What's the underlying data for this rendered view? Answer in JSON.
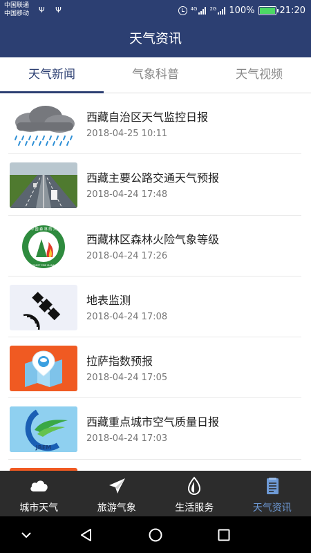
{
  "status_bar": {
    "carrier_1": "中国联通",
    "carrier_2": "中国移动",
    "net_label_1": "4G",
    "net_label_2": "2G",
    "battery": "100%",
    "time": "21:20"
  },
  "header": {
    "title": "天气资讯"
  },
  "tabs": [
    {
      "label": "天气新闻",
      "active": true
    },
    {
      "label": "气象科普",
      "active": false
    },
    {
      "label": "天气视频",
      "active": false
    }
  ],
  "news": [
    {
      "title": "西藏自治区天气监控日报",
      "date": "2018-04-25 10:11",
      "thumb": "rain-cloud"
    },
    {
      "title": "西藏主要公路交通天气预报",
      "date": "2018-04-24 17:48",
      "thumb": "highway-photo"
    },
    {
      "title": "西藏林区森林火险气象等级",
      "date": "2018-04-24 17:26",
      "thumb": "forest-fire-emblem"
    },
    {
      "title": "地表监测",
      "date": "2018-04-24 17:08",
      "thumb": "satellite"
    },
    {
      "title": "拉萨指数预报",
      "date": "2018-04-24 17:05",
      "thumb": "map-pin"
    },
    {
      "title": "西藏重点城市空气质量日报",
      "date": "2018-04-24 17:03",
      "thumb": "jbem-logo"
    }
  ],
  "forest_emblem": {
    "top_text": "中 国 森 林 防 火",
    "bottom_text": "CHINA FOREST FIRE MANAGEMENT"
  },
  "air_logo_text": "JBEM",
  "bottom_nav": [
    {
      "label": "城市天气",
      "icon": "cloud-icon",
      "active": false
    },
    {
      "label": "旅游气象",
      "icon": "paper-plane-icon",
      "active": false
    },
    {
      "label": "生活服务",
      "icon": "leaf-drop-icon",
      "active": false
    },
    {
      "label": "天气资讯",
      "icon": "news-document-icon",
      "active": true
    }
  ],
  "colors": {
    "primary": "#2c3f72",
    "active_nav": "#6e9ad6",
    "nav_bg": "#2c2c2c"
  }
}
